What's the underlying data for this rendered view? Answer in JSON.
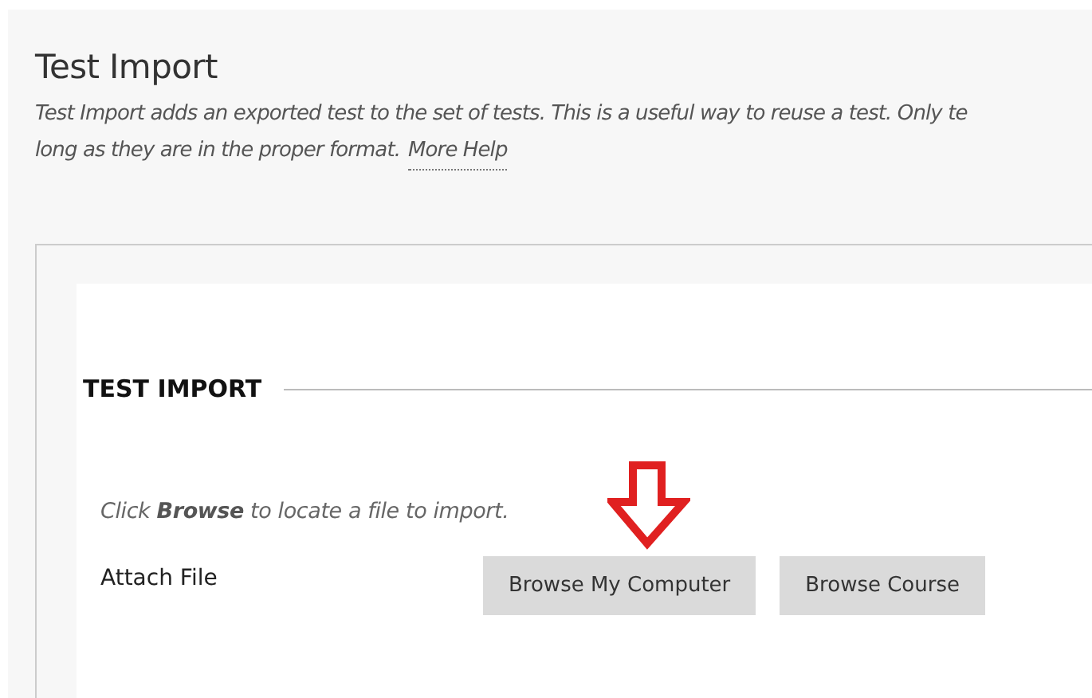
{
  "header": {
    "title": "Test Import",
    "description": "Test Import adds an exported test to the set of tests. This is a useful way to reuse a test. Only te",
    "description_2": "long as they are in the proper format.",
    "help_link": "More Help"
  },
  "section": {
    "heading": "TEST IMPORT",
    "instruction": "Click **Browse** to locate a file to import.",
    "field_label": "Attach File",
    "buttons": [
      "Browse My Computer",
      "Browse Course"
    ]
  }
}
